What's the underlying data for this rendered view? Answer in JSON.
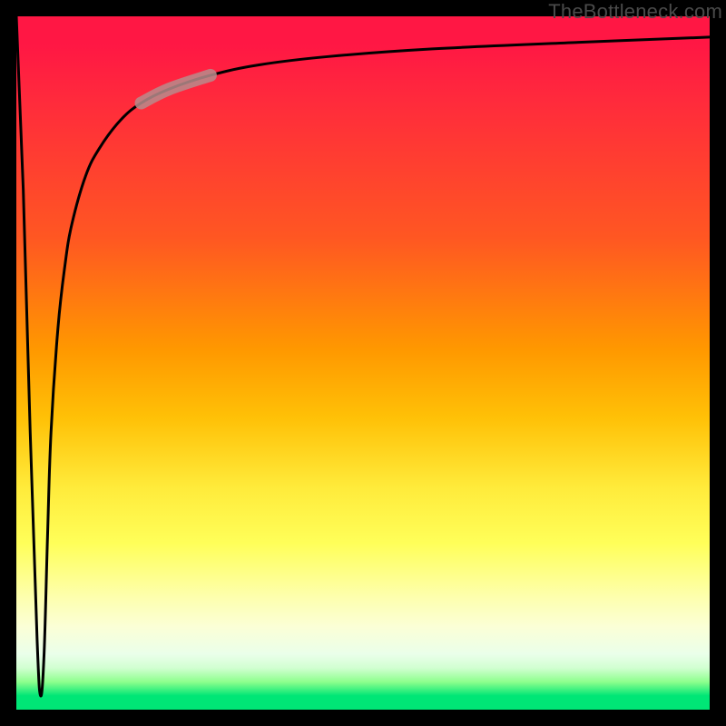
{
  "attribution": "TheBottleneck.com",
  "colors": {
    "frame": "#000000",
    "gradient_top": "#ff1744",
    "gradient_mid": "#ffeb3b",
    "gradient_bottom": "#00e676",
    "curve": "#000000",
    "highlight": "#b78c8c"
  },
  "chart_data": {
    "type": "line",
    "title": "",
    "xlabel": "",
    "ylabel": "",
    "xlim": [
      0,
      100
    ],
    "ylim": [
      0,
      100
    ],
    "grid": false,
    "legend": false,
    "annotations": [
      {
        "text": "TheBottleneck.com",
        "position": "top-right"
      }
    ],
    "series": [
      {
        "name": "curve",
        "x": [
          0,
          1,
          2,
          3,
          3.5,
          4,
          4.5,
          5,
          6,
          7,
          8,
          10,
          12,
          15,
          18,
          22,
          28,
          35,
          45,
          60,
          80,
          100
        ],
        "y": [
          100,
          75,
          40,
          10,
          2,
          8,
          25,
          40,
          55,
          64,
          70,
          77,
          81,
          85,
          87.5,
          89.5,
          91.5,
          93,
          94.2,
          95.3,
          96.2,
          97
        ]
      }
    ],
    "highlight_segment": {
      "series": "curve",
      "x_start": 18,
      "x_end": 28,
      "note": "thick pale rose overlay on curve"
    }
  }
}
